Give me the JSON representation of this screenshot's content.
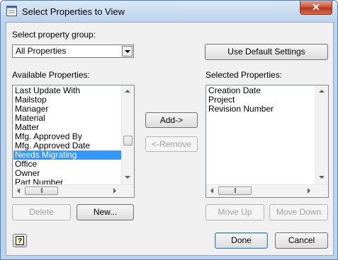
{
  "window": {
    "title": "Select Properties to View",
    "close_label": "✕"
  },
  "group": {
    "label": "Select property group:",
    "selected": "All Properties"
  },
  "buttons": {
    "use_default": "Use Default Settings",
    "add": "Add->",
    "remove": "<-Remove",
    "delete": "Delete",
    "new": "New...",
    "move_up": "Move Up",
    "move_down": "Move Down",
    "done": "Done",
    "cancel": "Cancel"
  },
  "available": {
    "label": "Available Properties:",
    "items": [
      "Last Update With",
      "Mailstop",
      "Manager",
      "Material",
      "Matter",
      "Mfg. Approved By",
      "Mfg. Approved Date",
      "Needs Migrating",
      "Office",
      "Owner",
      "Part Number"
    ],
    "selected_item": "Needs Migrating"
  },
  "selected": {
    "label": "Selected Properties:",
    "items": [
      "Creation Date",
      "Project",
      "Revision Number"
    ]
  },
  "icons": {
    "help": "help-icon",
    "app": "app-icon",
    "scroll_grip": "scroll-grip-icon"
  },
  "colors": {
    "selection": "#3399ff",
    "titlebar": "#bcd3ee",
    "close": "#c8503a"
  }
}
